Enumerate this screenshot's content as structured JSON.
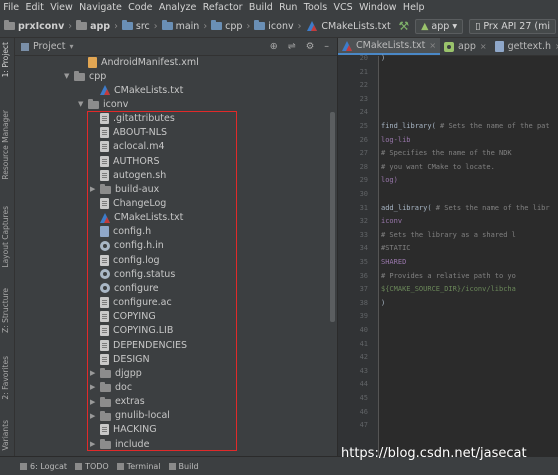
{
  "menu": [
    "File",
    "Edit",
    "View",
    "Navigate",
    "Code",
    "Analyze",
    "Refactor",
    "Build",
    "Run",
    "Tools",
    "VCS",
    "Window",
    "Help"
  ],
  "breadcrumb": [
    "prxIconv",
    "app",
    "src",
    "main",
    "cpp",
    "iconv",
    "CMakeLists.txt"
  ],
  "run_config": "app",
  "device": "Prx API 27 (mi",
  "left_tabs": [
    "1: Project",
    "Resource Manager",
    "Layout Captures",
    "Z: Structure",
    "2: Favorites",
    "Variants"
  ],
  "project_panel": {
    "title": "Project"
  },
  "tree": [
    {
      "label": "AndroidManifest.xml",
      "icon": "xml-file-icon",
      "arrow": ""
    },
    {
      "label": "cpp",
      "icon": "folder-icon",
      "arrow": "▼"
    },
    {
      "label": "CMakeLists.txt",
      "icon": "cmake-icon",
      "arrow": ""
    },
    {
      "label": "iconv",
      "icon": "folder-icon",
      "arrow": "▼"
    },
    {
      "label": ".gitattributes",
      "icon": "text-file-icon",
      "arrow": ""
    },
    {
      "label": "ABOUT-NLS",
      "icon": "text-file-icon",
      "arrow": ""
    },
    {
      "label": "aclocal.m4",
      "icon": "text-file-icon",
      "arrow": ""
    },
    {
      "label": "AUTHORS",
      "icon": "text-file-icon",
      "arrow": ""
    },
    {
      "label": "autogen.sh",
      "icon": "text-file-icon",
      "arrow": ""
    },
    {
      "label": "build-aux",
      "icon": "folder-icon",
      "arrow": "▶"
    },
    {
      "label": "ChangeLog",
      "icon": "text-file-icon",
      "arrow": ""
    },
    {
      "label": "CMakeLists.txt",
      "icon": "cmake-icon",
      "arrow": ""
    },
    {
      "label": "config.h",
      "icon": "header-file-icon",
      "arrow": ""
    },
    {
      "label": "config.h.in",
      "icon": "gear-icon",
      "arrow": ""
    },
    {
      "label": "config.log",
      "icon": "text-file-icon",
      "arrow": ""
    },
    {
      "label": "config.status",
      "icon": "gear-icon",
      "arrow": ""
    },
    {
      "label": "configure",
      "icon": "gear-icon",
      "arrow": ""
    },
    {
      "label": "configure.ac",
      "icon": "text-file-icon",
      "arrow": ""
    },
    {
      "label": "COPYING",
      "icon": "text-file-icon",
      "arrow": ""
    },
    {
      "label": "COPYING.LIB",
      "icon": "text-file-icon",
      "arrow": ""
    },
    {
      "label": "DEPENDENCIES",
      "icon": "text-file-icon",
      "arrow": ""
    },
    {
      "label": "DESIGN",
      "icon": "text-file-icon",
      "arrow": ""
    },
    {
      "label": "djgpp",
      "icon": "folder-icon",
      "arrow": "▶"
    },
    {
      "label": "doc",
      "icon": "folder-icon",
      "arrow": "▶"
    },
    {
      "label": "extras",
      "icon": "folder-icon",
      "arrow": "▶"
    },
    {
      "label": "gnulib-local",
      "icon": "folder-icon",
      "arrow": "▶"
    },
    {
      "label": "HACKING",
      "icon": "text-file-icon",
      "arrow": ""
    },
    {
      "label": "include",
      "icon": "folder-icon",
      "arrow": "▶"
    }
  ],
  "editor_tabs": [
    {
      "label": "CMakeLists.txt",
      "active": true
    },
    {
      "label": "app",
      "active": false
    },
    {
      "label": "gettext.h",
      "active": false
    }
  ],
  "line_numbers": [
    "20",
    "21",
    "22",
    "23",
    "24",
    "25",
    "26",
    "27",
    "28",
    "29",
    "30",
    "31",
    "32",
    "33",
    "34",
    "35",
    "36",
    "37",
    "38",
    "39",
    "40",
    "41",
    "42",
    "43",
    "44",
    "45",
    "46",
    "47"
  ],
  "code_lines": [
    {
      "text": ")",
      "cls": ""
    },
    {
      "text": "",
      "cls": ""
    },
    {
      "text": "",
      "cls": ""
    },
    {
      "text": "",
      "cls": ""
    },
    {
      "text": "",
      "cls": ""
    },
    {
      "text": "find_library( # Sets the name of the pat",
      "cls": "mixed1"
    },
    {
      "text": "        log-lib",
      "cls": "id"
    },
    {
      "text": "        # Specifies the name of the NDK",
      "cls": "cm"
    },
    {
      "text": "        # you want CMake to locate.",
      "cls": "cm"
    },
    {
      "text": "        log)",
      "cls": "id"
    },
    {
      "text": "",
      "cls": ""
    },
    {
      "text": "add_library( # Sets the name of the libr",
      "cls": "mixed2"
    },
    {
      "text": "        iconv",
      "cls": "id"
    },
    {
      "text": "        # Sets the library as a shared l",
      "cls": "cm"
    },
    {
      "text": "        #STATIC",
      "cls": "cm"
    },
    {
      "text": "        SHARED",
      "cls": "id"
    },
    {
      "text": "        # Provides a relative path to yo",
      "cls": "cm"
    },
    {
      "text": "        ${CMAKE_SOURCE_DIR}/iconv/libcha",
      "cls": "str"
    },
    {
      "text": "        )",
      "cls": ""
    },
    {
      "text": "",
      "cls": ""
    }
  ],
  "bottom_tools": [
    "6: Logcat",
    "TODO",
    "Terminal",
    "Build"
  ],
  "watermark": "https://blog.csdn.net/jasecat"
}
